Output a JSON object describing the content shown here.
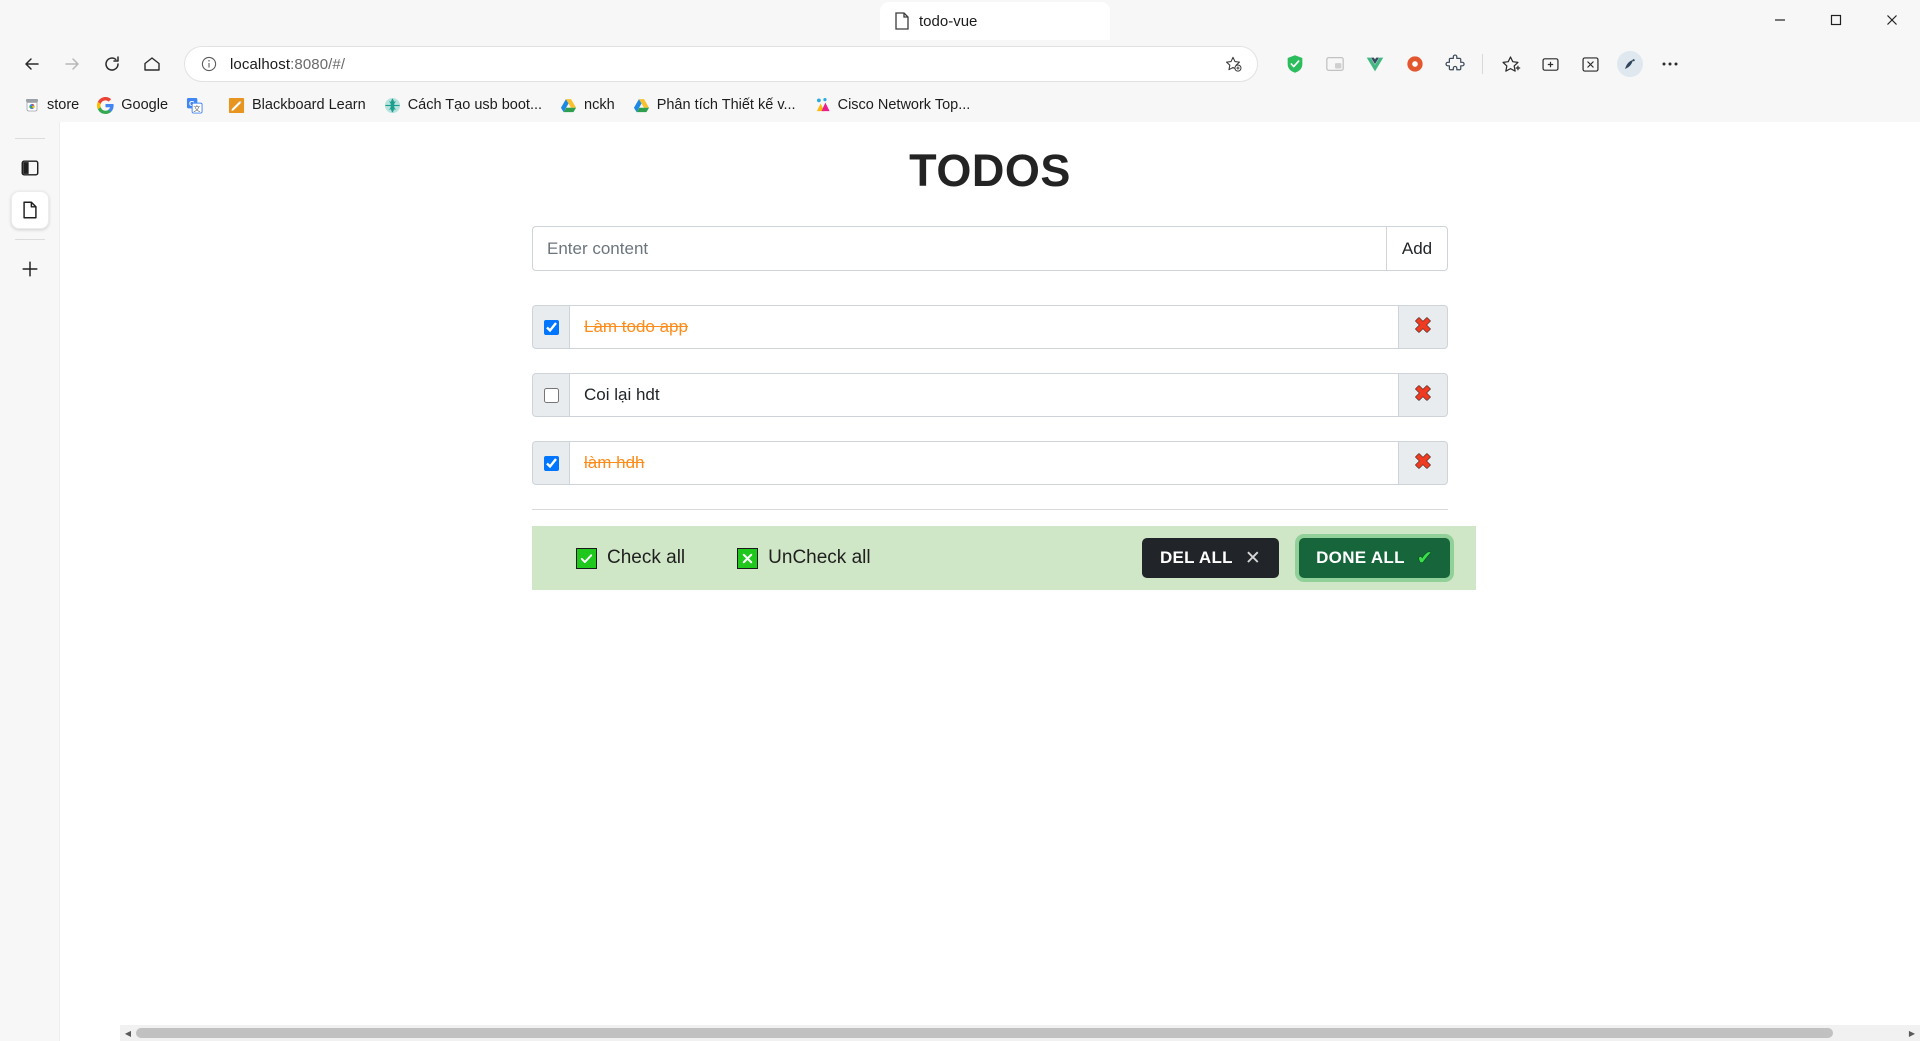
{
  "browser": {
    "tab": {
      "title": "todo-vue",
      "favicon": "document-icon"
    },
    "window_controls": {
      "minimize": "minimize-icon",
      "maximize": "maximize-icon",
      "close": "close-icon"
    },
    "nav": {
      "back": "back-arrow-icon",
      "forward": "forward-arrow-icon",
      "refresh": "refresh-icon",
      "home": "home-icon"
    },
    "address": {
      "info_icon": "info-circle-icon",
      "url_host": "localhost",
      "url_path": ":8080/#/",
      "favorite_icon": "star-add-icon"
    },
    "extensions": [
      {
        "name": "shield-green-icon"
      },
      {
        "name": "picture-in-picture-icon"
      },
      {
        "name": "vue-devtools-icon"
      },
      {
        "name": "adblock-icon"
      },
      {
        "name": "extensions-puzzle-icon"
      },
      {
        "name": "collections-favorites-icon"
      },
      {
        "name": "collections-icon"
      },
      {
        "name": "office-icon"
      },
      {
        "name": "profile-avatar-icon"
      },
      {
        "name": "settings-more-icon"
      }
    ],
    "bookmarks": [
      {
        "label": "store",
        "icon": "chrome-store-icon"
      },
      {
        "label": "Google",
        "icon": "google-icon"
      },
      {
        "label": "",
        "icon": "google-translate-icon"
      },
      {
        "label": "Blackboard Learn",
        "icon": "blackboard-icon"
      },
      {
        "label": "Cách Tạo usb boot...",
        "icon": "teal-globe-icon"
      },
      {
        "label": "nckh",
        "icon": "google-drive-icon"
      },
      {
        "label": "Phân tích Thiết kế v...",
        "icon": "google-drive-icon"
      },
      {
        "label": "Cisco Network Top...",
        "icon": "cisco-packet-tracer-icon"
      }
    ],
    "sidebar": [
      {
        "name": "sidebar-copilot-icon",
        "active": false
      },
      {
        "name": "sidebar-page-icon",
        "active": true
      },
      {
        "name": "sidebar-add-icon",
        "active": false
      }
    ]
  },
  "app": {
    "title": "TODOS",
    "add_form": {
      "placeholder": "Enter content",
      "value": "",
      "button_label": "Add"
    },
    "todos": [
      {
        "text": "Làm todo app",
        "done": true
      },
      {
        "text": "Coi lại hdt",
        "done": false
      },
      {
        "text": "làm hdh",
        "done": true
      }
    ],
    "delete_icon": "red-x-icon",
    "footer": {
      "check_all_label": "Check all",
      "check_all_icon": "green-check-box-icon",
      "uncheck_all_label": "UnCheck all",
      "uncheck_all_icon": "green-x-box-icon",
      "del_all_label": "DEL ALL",
      "del_all_icon": "x-icon",
      "done_all_label": "DONE ALL",
      "done_all_icon": "check-icon"
    },
    "colors": {
      "done_text": "#fd8c1a",
      "footer_bg": "#cfe7c6",
      "del_all_bg": "#212529",
      "done_all_bg": "#17653a",
      "delete_x": "#ef3b21"
    }
  }
}
